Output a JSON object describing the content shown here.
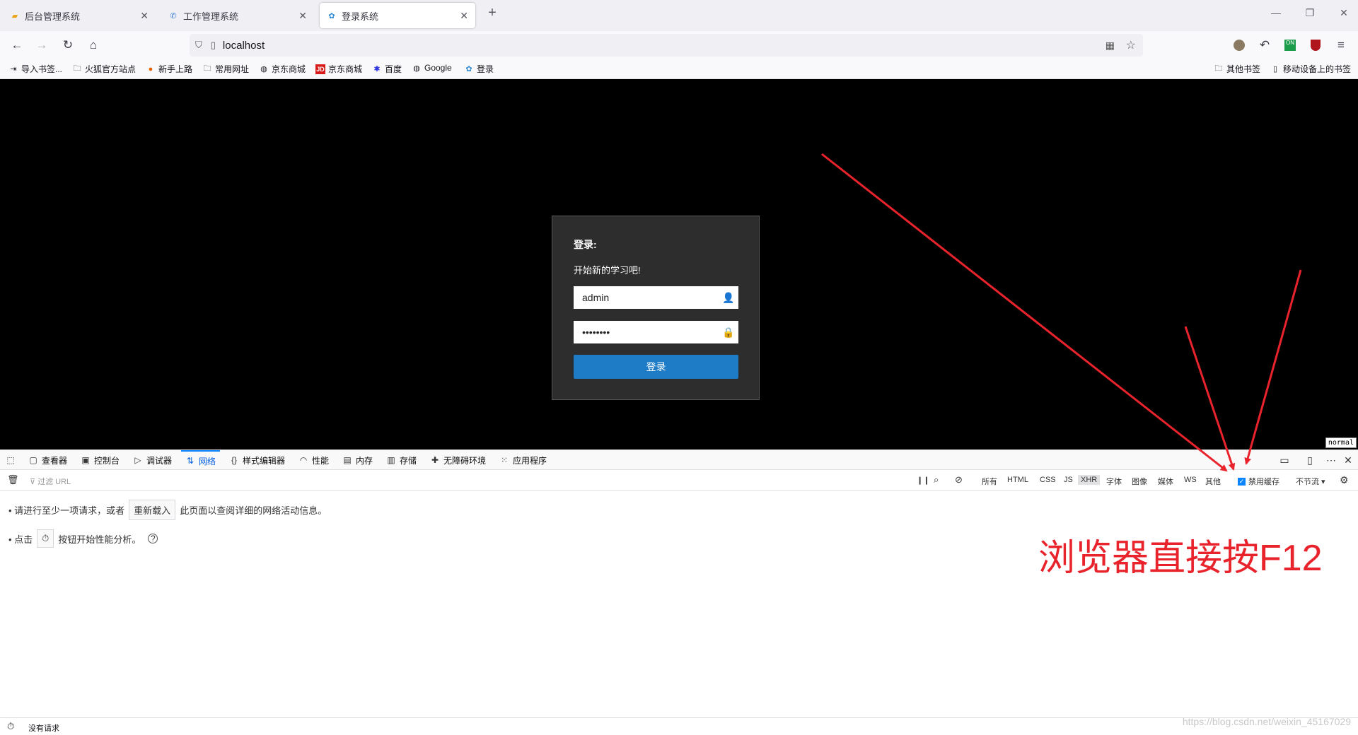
{
  "browser": {
    "tabs": [
      {
        "title": "后台管理系统",
        "icon": "folder-icon",
        "active": false
      },
      {
        "title": "工作管理系统",
        "icon": "phone-icon",
        "active": false
      },
      {
        "title": "登录系统",
        "icon": "lotus-icon",
        "active": true
      }
    ],
    "url": "localhost",
    "bookmarks": [
      {
        "label": "导入书签...",
        "icon": "import-icon"
      },
      {
        "label": "火狐官方站点",
        "icon": "folder-icon"
      },
      {
        "label": "新手上路",
        "icon": "firefox-icon"
      },
      {
        "label": "常用网址",
        "icon": "folder-icon"
      },
      {
        "label": "京东商城",
        "icon": "globe-icon"
      },
      {
        "label": "京东商城",
        "icon": "jd-icon"
      },
      {
        "label": "百度",
        "icon": "baidu-icon"
      },
      {
        "label": "Google",
        "icon": "globe-icon"
      },
      {
        "label": "登录",
        "icon": "lotus-icon"
      }
    ],
    "bookmarks_right": [
      {
        "label": "其他书签",
        "icon": "folder-icon"
      },
      {
        "label": "移动设备上的书签",
        "icon": "mobile-icon"
      }
    ]
  },
  "page": {
    "login_title": "登录:",
    "login_subtitle": "开始新的学习吧!",
    "username_value": "admin",
    "password_value": "••••••••",
    "login_button": "登录",
    "mode_tag": "normal"
  },
  "devtools": {
    "tabs": [
      {
        "label": "查看器",
        "icon": "inspector-icon",
        "active": false
      },
      {
        "label": "控制台",
        "icon": "console-icon",
        "active": false
      },
      {
        "label": "调试器",
        "icon": "debugger-icon",
        "active": false
      },
      {
        "label": "网络",
        "icon": "network-icon",
        "active": true
      },
      {
        "label": "样式编辑器",
        "icon": "style-editor-icon",
        "active": false
      },
      {
        "label": "性能",
        "icon": "performance-icon",
        "active": false
      },
      {
        "label": "内存",
        "icon": "memory-icon",
        "active": false
      },
      {
        "label": "存储",
        "icon": "storage-icon",
        "active": false
      },
      {
        "label": "无障碍环境",
        "icon": "accessibility-icon",
        "active": false
      },
      {
        "label": "应用程序",
        "icon": "application-icon",
        "active": false
      }
    ],
    "filter_placeholder": "过滤 URL",
    "filters": [
      "所有",
      "HTML",
      "CSS",
      "JS",
      "XHR",
      "字体",
      "图像",
      "媒体",
      "WS",
      "其他"
    ],
    "selected_filter": "XHR",
    "disable_cache_label": "禁用缓存",
    "disable_cache_checked": true,
    "throttle_label": "不节流 ▾",
    "message1_prefix": "• 请进行至少一项请求，或者",
    "reload_button": "重新载入",
    "message1_suffix": "此页面以查阅详细的网络活动信息。",
    "message2_prefix": "• 点击",
    "message2_suffix": "按钮开始性能分析。",
    "status_text": "没有请求",
    "annotation": "浏览器直接按F12",
    "watermark": "https://blog.csdn.net/weixin_45167029",
    "accent_color": "#0a84ff",
    "annotation_color": "#e8232c"
  }
}
